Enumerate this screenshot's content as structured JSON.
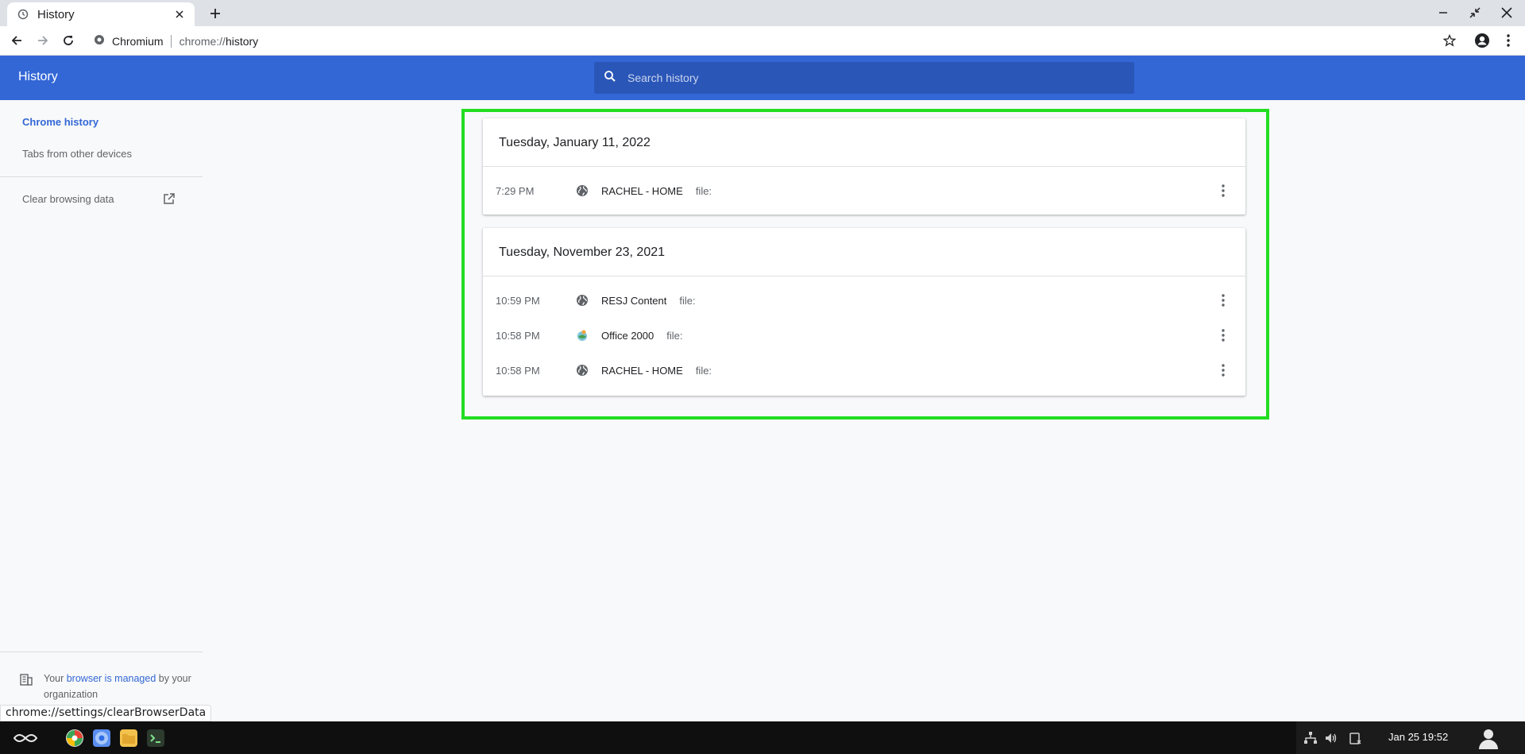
{
  "browser": {
    "tab_title": "History",
    "omnibox": {
      "site_chip": "Chromium",
      "url_scheme": "chrome://",
      "url_path": "history"
    }
  },
  "header": {
    "title": "History",
    "search_placeholder": "Search history"
  },
  "sidebar": {
    "items": [
      {
        "label": "Chrome history",
        "active": true
      },
      {
        "label": "Tabs from other devices",
        "active": false
      }
    ],
    "clear_label": "Clear browsing data",
    "managed": {
      "prefix": "Your ",
      "link": "browser is managed",
      "suffix": " by your organization"
    }
  },
  "history": {
    "days": [
      {
        "date": "Tuesday, January 11, 2022",
        "entries": [
          {
            "time": "7:29 PM",
            "title": "RACHEL - HOME",
            "domain": "file:",
            "icon": "globe-icon"
          }
        ]
      },
      {
        "date": "Tuesday, November 23, 2021",
        "entries": [
          {
            "time": "10:59 PM",
            "title": "RESJ Content",
            "domain": "file:",
            "icon": "globe-icon"
          },
          {
            "time": "10:58 PM",
            "title": "Office 2000",
            "domain": "file:",
            "icon": "office-favicon"
          },
          {
            "time": "10:58 PM",
            "title": "RACHEL - HOME",
            "domain": "file:",
            "icon": "globe-icon"
          }
        ]
      }
    ]
  },
  "status_bar": {
    "url": "chrome://settings/clearBrowserData"
  },
  "taskbar": {
    "clock": "Jan 25  19:52"
  },
  "colors": {
    "accent": "#3367d6",
    "search_bg": "#2a56b8",
    "highlight": "#22dd22"
  }
}
